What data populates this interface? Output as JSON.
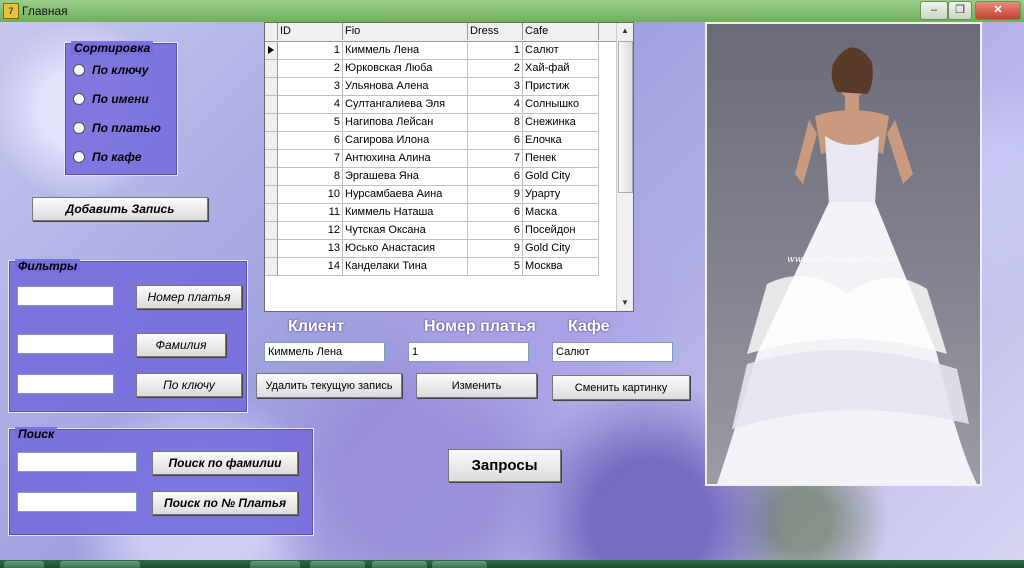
{
  "window": {
    "title": "Главная"
  },
  "sort": {
    "title": "Сортировка",
    "options": [
      "По ключу",
      "По имени",
      "По платью",
      "По кафе"
    ]
  },
  "add_button": "Добавить Запись",
  "filters": {
    "title": "Фильтры",
    "buttons": [
      "Номер платья",
      "Фамилия",
      "По ключу"
    ]
  },
  "search": {
    "title": "Поиск",
    "buttons": [
      "Поиск по фамилии",
      "Поиск по № Платья"
    ]
  },
  "grid": {
    "columns": [
      "ID",
      "Fio",
      "Dress",
      "Cafe"
    ],
    "rows": [
      [
        "1",
        "Киммель Лена",
        "1",
        "Салют"
      ],
      [
        "2",
        "Юрковская Люба",
        "2",
        "Хай-фай"
      ],
      [
        "3",
        "Ульянова Алена",
        "3",
        "Пристиж"
      ],
      [
        "4",
        "Султангалиева Эля",
        "4",
        "Солнышко"
      ],
      [
        "5",
        "Нагипова Лейсан",
        "8",
        "Снежинка"
      ],
      [
        "6",
        "Сагирова Илона",
        "6",
        "Елочка"
      ],
      [
        "7",
        "Антюхина Алина",
        "7",
        "Пенек"
      ],
      [
        "8",
        "Эргашева Яна",
        "6",
        "Gold City"
      ],
      [
        "10",
        "Нурсамбаева Аина",
        "9",
        "Урарту"
      ],
      [
        "11",
        "Киммель Наташа",
        "6",
        "Маска"
      ],
      [
        "12",
        "Чутская Оксана",
        "6",
        "Посейдон"
      ],
      [
        "13",
        "Юсько Анастасия",
        "9",
        "Gold City"
      ],
      [
        "14",
        "Канделаки Тина",
        "5",
        "Москва"
      ]
    ]
  },
  "details": {
    "client_label": "Клиент",
    "dress_label": "Номер платья",
    "cafe_label": "Кафе",
    "client_value": "Киммель Лена",
    "dress_value": "1",
    "cafe_value": "Салют"
  },
  "actions": {
    "delete": "Удалить текущую запись",
    "edit": "Изменить",
    "change_picture": "Сменить картинку",
    "queries": "Запросы"
  },
  "photo": {
    "watermark": "www.dozhinepotrong.ru"
  },
  "colors": {
    "panel": "#786edc",
    "titlebar": "#7fbb6a"
  }
}
